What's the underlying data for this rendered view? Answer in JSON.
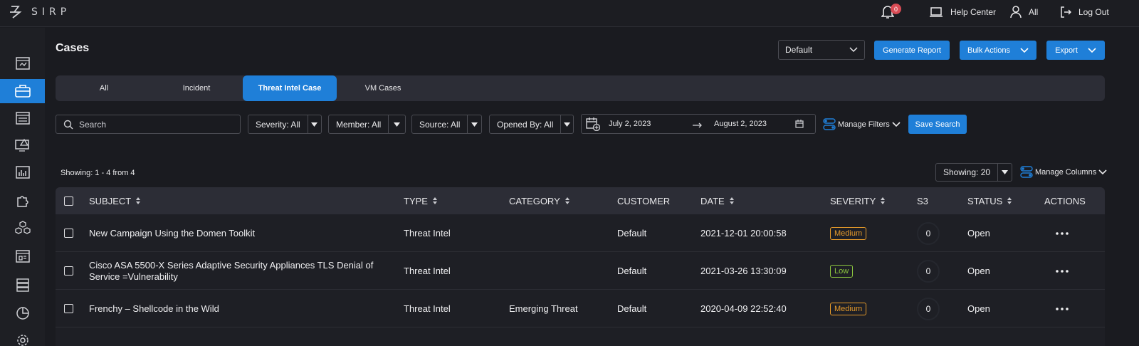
{
  "app": {
    "logo_text": "SIRP"
  },
  "topbar": {
    "notification_count": "0",
    "help_center": "Help Center",
    "user_label": "All",
    "logout": "Log Out"
  },
  "sidebar": {
    "items": [
      {
        "icon": "dashboard-icon",
        "active": false
      },
      {
        "icon": "briefcase-icon",
        "active": true
      },
      {
        "icon": "list-icon",
        "active": false
      },
      {
        "icon": "monitor-alert-icon",
        "active": false
      },
      {
        "icon": "chart-icon",
        "active": false
      },
      {
        "icon": "puzzle-icon",
        "active": false
      },
      {
        "icon": "cubes-icon",
        "active": false
      },
      {
        "icon": "report-icon",
        "active": false
      },
      {
        "icon": "database-icon",
        "active": false
      },
      {
        "icon": "pie-chart-icon",
        "active": false
      },
      {
        "icon": "settings-icon",
        "active": false
      }
    ]
  },
  "header": {
    "title": "Cases",
    "view_select": "Default",
    "generate_report": "Generate Report",
    "bulk_actions": "Bulk Actions",
    "export": "Export"
  },
  "tabs": [
    {
      "label": "All",
      "active": false
    },
    {
      "label": "Incident",
      "active": false
    },
    {
      "label": "Threat Intel Case",
      "active": true
    },
    {
      "label": "VM Cases",
      "active": false
    }
  ],
  "filters": {
    "search_placeholder": "Search",
    "severity": "Severity: All",
    "member": "Member: All",
    "source": "Source: All",
    "opened_by": "Opened By: All",
    "date_from": "July 2, 2023",
    "date_to": "August 2, 2023",
    "manage_filters": "Manage Filters",
    "save_search": "Save Search"
  },
  "listing": {
    "showing_text": "Showing: 1 - 4 from 4",
    "page_size": "Showing: 20",
    "manage_columns": "Manage Columns"
  },
  "table": {
    "columns": [
      "SUBJECT",
      "TYPE",
      "CATEGORY",
      "CUSTOMER",
      "DATE",
      "SEVERITY",
      "S3",
      "STATUS",
      "ACTIONS"
    ],
    "rows": [
      {
        "subject": "New Campaign Using the Domen Toolkit",
        "type": "Threat Intel",
        "category": "",
        "customer": "Default",
        "date": "2021-12-01 20:00:58",
        "severity": "Medium",
        "s3": "0",
        "status": "Open"
      },
      {
        "subject": "Cisco ASA 5500-X Series Adaptive Security Appliances TLS Denial of Service =Vulnerability",
        "type": "Threat Intel",
        "category": "",
        "customer": "Default",
        "date": "2021-03-26 13:30:09",
        "severity": "Low",
        "s3": "0",
        "status": "Open"
      },
      {
        "subject": "Frenchy – Shellcode in the Wild",
        "type": "Threat Intel",
        "category": "Emerging Threat",
        "customer": "Default",
        "date": "2020-04-09 22:52:40",
        "severity": "Medium",
        "s3": "0",
        "status": "Open"
      }
    ]
  },
  "colors": {
    "accent": "#1f7fd8",
    "severity_medium": "#e59a2a",
    "severity_low": "#8cc63f"
  }
}
